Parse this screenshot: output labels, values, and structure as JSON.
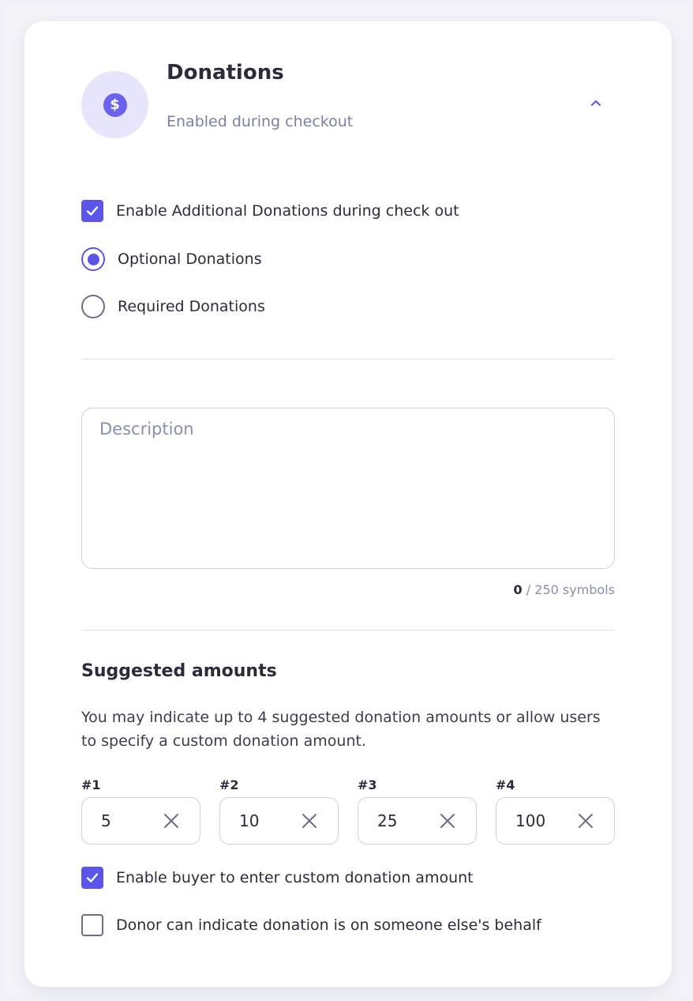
{
  "header": {
    "title": "Donations",
    "subtitle": "Enabled during checkout",
    "icon": "dollar-circle-icon",
    "toggle_icon": "chevron-up-icon"
  },
  "options": {
    "enable_additional": {
      "label": "Enable Additional Donations during check out",
      "checked": true
    },
    "optional": {
      "label": "Optional Donations",
      "selected": true
    },
    "required": {
      "label": "Required Donations",
      "selected": false
    }
  },
  "description": {
    "placeholder": "Description",
    "value": "",
    "count": "0",
    "limit_text": "/ 250 symbols"
  },
  "suggested": {
    "title": "Suggested amounts",
    "text": "You may indicate up to 4 suggested donation amounts or allow users to specify a custom donation amount.",
    "amounts": [
      {
        "label": "#1",
        "value": "5"
      },
      {
        "label": "#2",
        "value": "10"
      },
      {
        "label": "#3",
        "value": "25"
      },
      {
        "label": "#4",
        "value": "100"
      }
    ]
  },
  "extra": {
    "custom_amount": {
      "label": "Enable buyer to enter custom donation amount",
      "checked": true
    },
    "behalf": {
      "label": "Donor can indicate donation is on someone else's behalf",
      "checked": false
    }
  },
  "colors": {
    "accent": "#5b55e8",
    "avatar_bg": "#e6e5fb",
    "muted_text": "#7a7fa8"
  }
}
